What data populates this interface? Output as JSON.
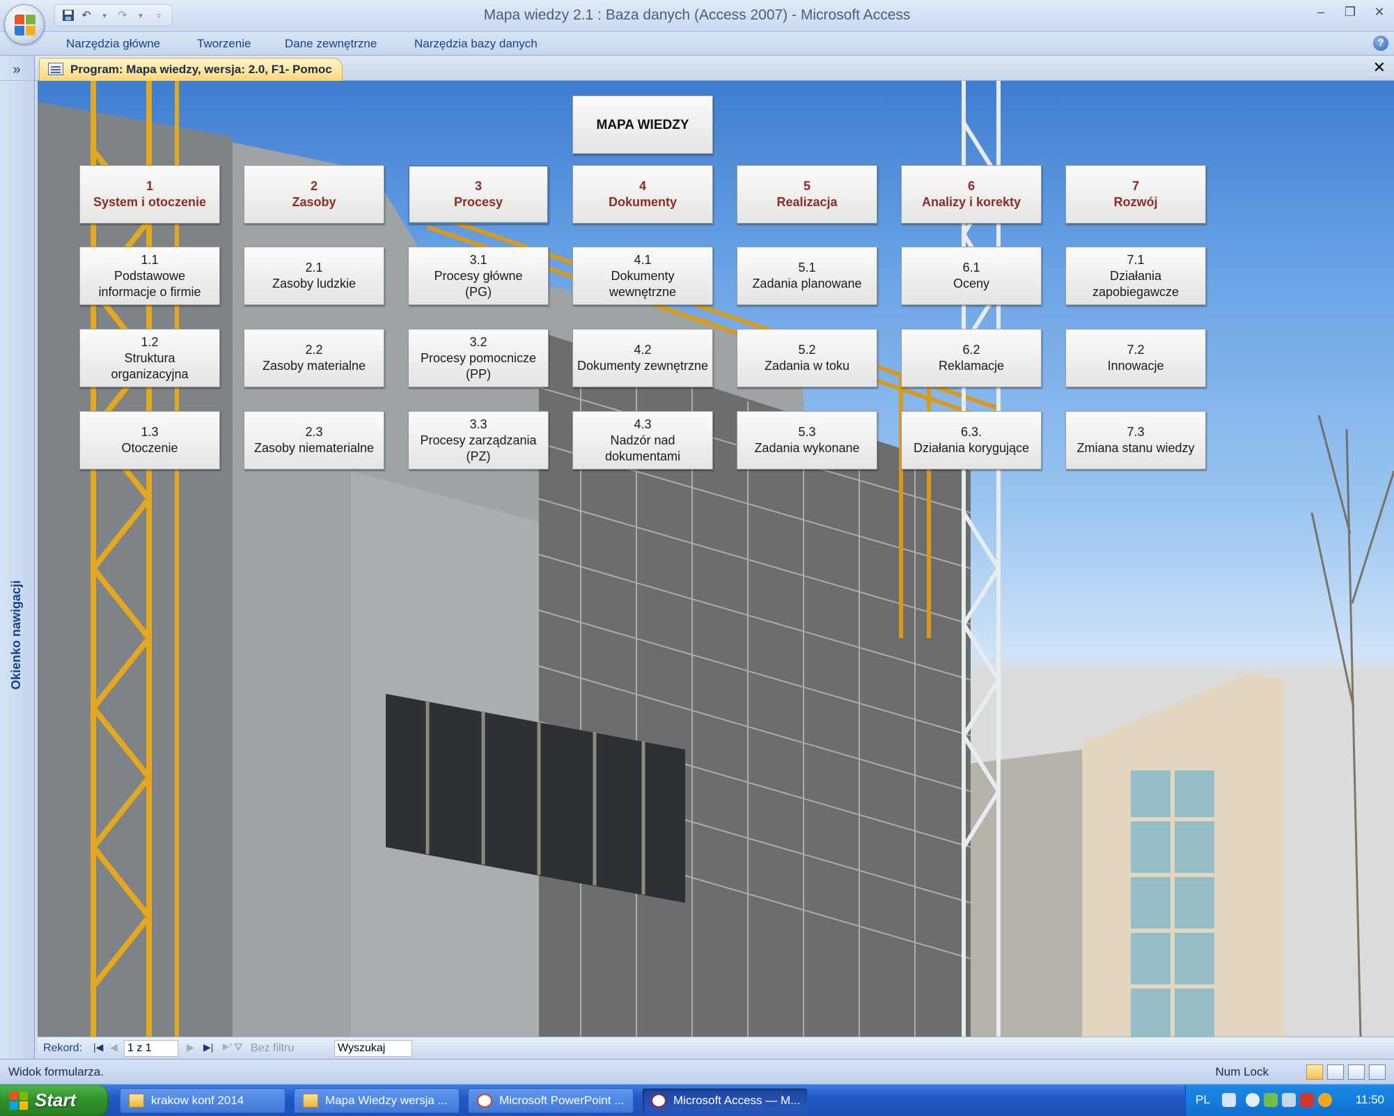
{
  "window": {
    "title": "Mapa wiedzy 2.1 : Baza danych (Access 2007) - Microsoft Access",
    "minimize": "–",
    "restore": "❐",
    "close": "✕"
  },
  "ribbon": {
    "tabs": [
      "Narzędzia główne",
      "Tworzenie",
      "Dane zewnętrzne",
      "Narzędzia bazy danych"
    ],
    "help": "?"
  },
  "nav_pane": {
    "toggle": "»",
    "label": "Okienko nawigacji"
  },
  "document_tab": {
    "label": "Program: Mapa wiedzy, wersja: 2.0, F1- Pomoc",
    "close": "✕"
  },
  "form": {
    "top_button": "MAPA WIEDZY",
    "columns": [
      {
        "head": [
          "1",
          "System i otoczenie"
        ],
        "items": [
          [
            "1.1",
            "Podstawowe",
            "informacje o firmie"
          ],
          [
            "1.2",
            "Struktura",
            "organizacyjna"
          ],
          [
            "1.3",
            "Otoczenie"
          ]
        ]
      },
      {
        "head": [
          "2",
          "Zasoby"
        ],
        "items": [
          [
            "2.1",
            "Zasoby ludzkie"
          ],
          [
            "2.2",
            "Zasoby materialne"
          ],
          [
            "2.3",
            "Zasoby niematerialne"
          ]
        ]
      },
      {
        "head": [
          "3",
          "Procesy"
        ],
        "items": [
          [
            "3.1",
            "Procesy główne",
            "(PG)"
          ],
          [
            "3.2",
            "Procesy pomocnicze",
            "(PP)"
          ],
          [
            "3.3",
            "Procesy zarządzania",
            "(PZ)"
          ]
        ]
      },
      {
        "head": [
          "4",
          "Dokumenty"
        ],
        "items": [
          [
            "4.1",
            "Dokumenty",
            "wewnętrzne"
          ],
          [
            "4.2",
            "Dokumenty zewnętrzne"
          ],
          [
            "4.3",
            "Nadzór nad",
            "dokumentami"
          ]
        ]
      },
      {
        "head": [
          "5",
          "Realizacja"
        ],
        "items": [
          [
            "5.1",
            "Zadania planowane"
          ],
          [
            "5.2",
            "Zadania w toku"
          ],
          [
            "5.3",
            "Zadania wykonane"
          ]
        ]
      },
      {
        "head": [
          "6",
          "Analizy i korekty"
        ],
        "items": [
          [
            "6.1",
            "Oceny"
          ],
          [
            "6.2",
            "Reklamacje"
          ],
          [
            "6.3.",
            "Działania korygujące"
          ]
        ]
      },
      {
        "head": [
          "7",
          "Rozwój"
        ],
        "items": [
          [
            "7.1",
            "Działania",
            "zapobiegawcze"
          ],
          [
            "7.2",
            "Innowacje"
          ],
          [
            "7.3",
            "Zmiana stanu wiedzy"
          ]
        ]
      }
    ]
  },
  "record_bar": {
    "label": "Rekord:",
    "first": "|◀",
    "prev": "◀",
    "value": "1 z 1",
    "next": "▶",
    "last": "▶|",
    "new": "▶*",
    "filter_icon": "funnel-icon",
    "filter": "Bez filtru",
    "search": "Wyszukaj"
  },
  "status_bar": {
    "text": "Widok formularza.",
    "numlock": "Num Lock"
  },
  "taskbar": {
    "start": "Start",
    "tasks": [
      {
        "label": "krakow konf 2014",
        "icon": "folder-icon"
      },
      {
        "label": "Mapa Wiedzy wersja ...",
        "icon": "folder-icon"
      },
      {
        "label": "Microsoft PowerPoint ...",
        "icon": "powerpoint-icon"
      },
      {
        "label": "Microsoft Access — M...",
        "icon": "access-icon"
      }
    ],
    "lang": "PL",
    "clock": "11:50"
  },
  "colors": {
    "header_text": "#8e2b22",
    "taskbar": "#2258c7",
    "start": "#2f8f2a",
    "doc_tab": "#ffd77a"
  }
}
